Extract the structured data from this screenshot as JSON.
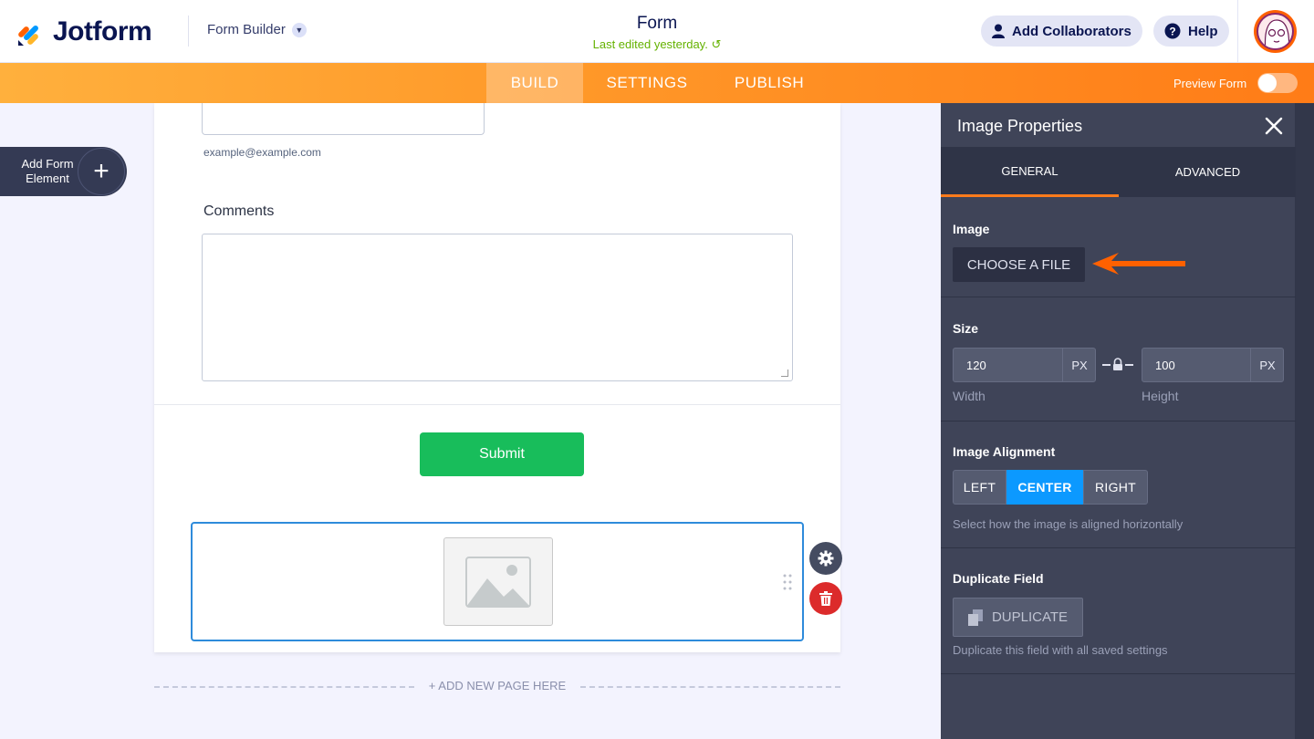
{
  "header": {
    "brand": "Jotform",
    "builder_menu": "Form Builder",
    "form_title": "Form",
    "last_edited": "Last edited yesterday.",
    "add_collaborators": "Add Collaborators",
    "help": "Help"
  },
  "nav": {
    "tabs": [
      "BUILD",
      "SETTINGS",
      "PUBLISH"
    ],
    "active_tab": "BUILD",
    "preview_label": "Preview Form",
    "preview_on": false
  },
  "sidebar": {
    "add_element_label": "Add Form Element"
  },
  "form": {
    "email_sublabel": "example@example.com",
    "comments_label": "Comments",
    "submit_label": "Submit",
    "add_page": "+ ADD NEW PAGE HERE"
  },
  "panel": {
    "title": "Image Properties",
    "tabs": [
      "GENERAL",
      "ADVANCED"
    ],
    "active_tab": "GENERAL",
    "image": {
      "title": "Image",
      "button": "CHOOSE A FILE"
    },
    "size": {
      "title": "Size",
      "width_value": "120",
      "height_value": "100",
      "unit": "PX",
      "width_label": "Width",
      "height_label": "Height"
    },
    "alignment": {
      "title": "Image Alignment",
      "options": [
        "LEFT",
        "CENTER",
        "RIGHT"
      ],
      "selected": "CENTER",
      "helper": "Select how the image is aligned horizontally"
    },
    "duplicate": {
      "title": "Duplicate Field",
      "button": "DUPLICATE",
      "helper": "Duplicate this field with all saved settings"
    }
  },
  "colors": {
    "brand_orange": "#ff7b1c",
    "accent_blue": "#0c99ff",
    "submit_green": "#18bd5b",
    "delete_red": "#dc2b2b",
    "panel_bg": "#3f4458"
  },
  "icons": [
    "jotform-logo-icon",
    "chevron-down-icon",
    "undo-icon",
    "user-icon",
    "help-icon",
    "plus-icon",
    "image-icon",
    "gear-icon",
    "trash-icon",
    "drag-handle-icon",
    "close-icon",
    "arrow-left-icon",
    "lock-icon",
    "duplicate-icon"
  ]
}
